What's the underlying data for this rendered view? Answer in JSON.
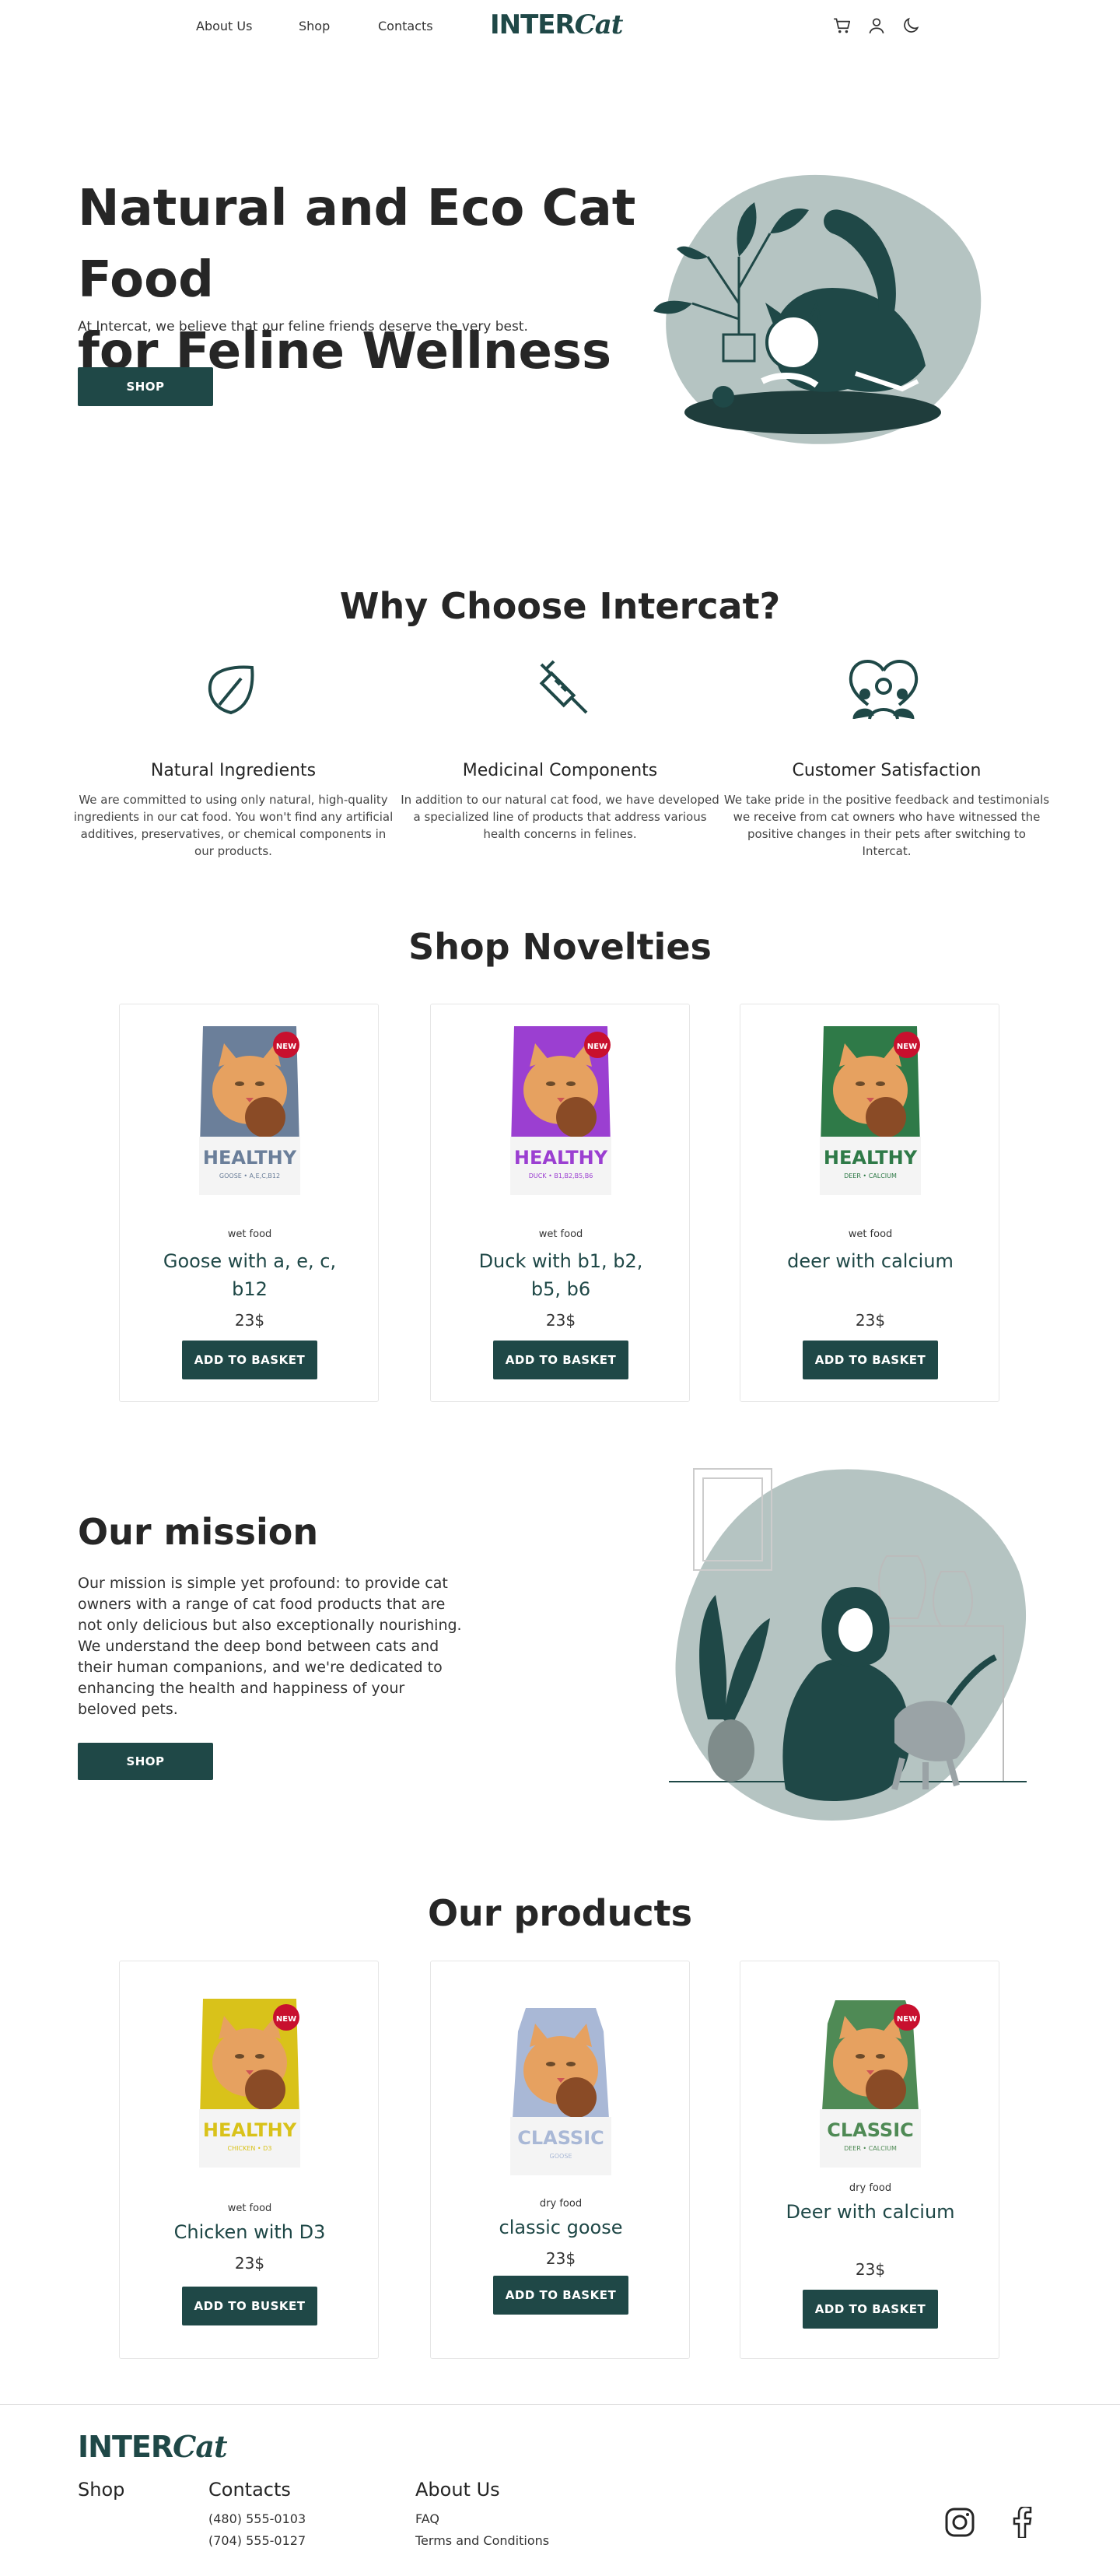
{
  "header": {
    "nav": [
      "About Us",
      "Shop",
      "Contacts"
    ],
    "logo_main": "INTER",
    "logo_cat": "Cat",
    "icons": [
      "cart-icon",
      "user-icon",
      "moon-icon"
    ]
  },
  "hero": {
    "title_line1": "Natural and Eco Cat Food",
    "title_line2": "for Feline Wellness",
    "subtitle": "At Intercat, we believe that our feline friends deserve the very best.",
    "button": "SHOP"
  },
  "why": {
    "title": "Why Choose Intercat?",
    "features": [
      {
        "icon": "leaf-icon",
        "title": "Natural Ingredients",
        "text": "We are committed to using only natural, high-quality ingredients in our cat food. You won't find any artificial additives, preservatives, or chemical components in our products."
      },
      {
        "icon": "syringe-icon",
        "title": "Medicinal Components",
        "text": "In addition to our natural cat food, we have developed a specialized line of products that address various health concerns in felines."
      },
      {
        "icon": "heart-people-icon",
        "title": "Customer Satisfaction",
        "text": "We take pride in the positive feedback and testimonials we receive from cat owners who have witnessed the positive changes in their pets after switching to Intercat."
      }
    ]
  },
  "novelties": {
    "title": "Shop Novelties",
    "products": [
      {
        "type": "wet food",
        "name": "Goose with a, e, c, b12",
        "price": "23$",
        "button": "ADD TO BASKET",
        "pack_label": "HEALTHY",
        "pack_sub": "GOOSE • A,E,C,B12",
        "badge": "NEW",
        "color": "#6b7f9a"
      },
      {
        "type": "wet food",
        "name": "Duck with b1, b2, b5, b6",
        "price": "23$",
        "button": "ADD TO BASKET",
        "pack_label": "HEALTHY",
        "pack_sub": "DUCK • B1,B2,B5,B6",
        "badge": "NEW",
        "color": "#9b3fd1"
      },
      {
        "type": "wet food",
        "name": "deer with calcium",
        "price": "23$",
        "button": "ADD TO BASKET",
        "pack_label": "HEALTHY",
        "pack_sub": "DEER • CALCIUM",
        "badge": "NEW",
        "color": "#2f7a48"
      }
    ]
  },
  "mission": {
    "title": "Our mission",
    "text": "Our mission is simple yet profound: to provide cat owners with a range of cat food products that are not only delicious but also exceptionally nourishing. We understand the deep bond between cats and their human companions, and we're dedicated to enhancing the health and happiness of your beloved pets.",
    "button": "SHOP"
  },
  "products": {
    "title": "Our products",
    "items": [
      {
        "type": "wet food",
        "name": "Chicken with D3",
        "price": "23$",
        "button": "ADD TO BUSKET",
        "pack_label": "HEALTHY",
        "pack_sub": "CHICKEN • D3",
        "badge": "NEW",
        "color": "#d9c21a"
      },
      {
        "type": "dry food",
        "name": "classic goose",
        "price": "23$",
        "button": "ADD TO BASKET",
        "pack_label": "CLASSIC",
        "pack_sub": "GOOSE",
        "color": "#a9b8d6"
      },
      {
        "type": "dry food",
        "name": "Deer with calcium",
        "price": "23$",
        "button": "ADD TO BASKET",
        "pack_label": "CLASSIC",
        "pack_sub": "DEER • CALCIUM",
        "badge": "NEW",
        "color": "#4f8a55"
      }
    ]
  },
  "footer": {
    "logo_main": "INTER",
    "logo_cat": "Cat",
    "shop": "Shop",
    "contacts": "Contacts",
    "phones": [
      "(480) 555-0103",
      "(704) 555-0127"
    ],
    "about": "About Us",
    "about_links": [
      "FAQ",
      "Terms and Conditions"
    ],
    "social": [
      "instagram-icon",
      "facebook-icon"
    ]
  },
  "colors": {
    "accent": "#1f4847",
    "blob": "#b5c4c2",
    "text": "#262626"
  }
}
